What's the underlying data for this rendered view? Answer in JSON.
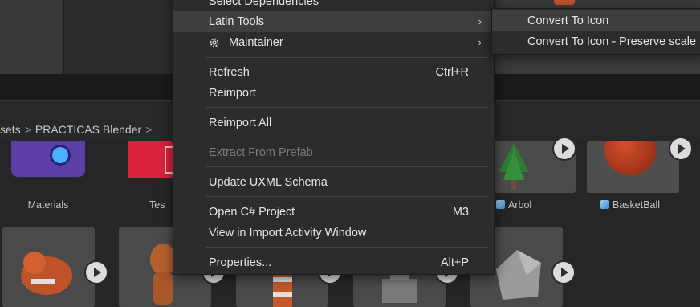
{
  "breadcrumb": [
    "sets",
    "PRACTICAS Blender",
    ""
  ],
  "assets_row1": [
    {
      "label": "Materials"
    },
    {
      "label": "Tes"
    },
    {
      "label": "Arbol",
      "prefab": true
    },
    {
      "label": "BasketBall",
      "prefab": true
    }
  ],
  "context_menu": {
    "items": [
      {
        "label": "Select Dependencies"
      },
      {
        "label": "Latin Tools",
        "submenu": true,
        "highlighted": true
      },
      {
        "label": "Maintainer",
        "submenu": true,
        "icon": "gear-icon"
      },
      {
        "label": "Refresh",
        "shortcut": "Ctrl+R"
      },
      {
        "label": "Reimport"
      },
      {
        "label": "Reimport All"
      },
      {
        "label": "Extract From Prefab",
        "disabled": true
      },
      {
        "label": "Update UXML Schema"
      },
      {
        "label": "Open C# Project",
        "shortcut": "M3"
      },
      {
        "label": "View in Import Activity Window"
      },
      {
        "label": "Properties...",
        "shortcut": "Alt+P"
      }
    ],
    "arrow": "›"
  },
  "submenu": {
    "items": [
      {
        "label": "Convert To Icon",
        "highlighted": true
      },
      {
        "label": "Convert To Icon - Preserve scale"
      }
    ]
  },
  "colors": {
    "menu_bg": "#2c2c2c",
    "highlight": "#3e3e3e",
    "disabled": "#7a7a7a",
    "material_icon": "#5b3ea8",
    "red_asset": "#d9233c"
  }
}
